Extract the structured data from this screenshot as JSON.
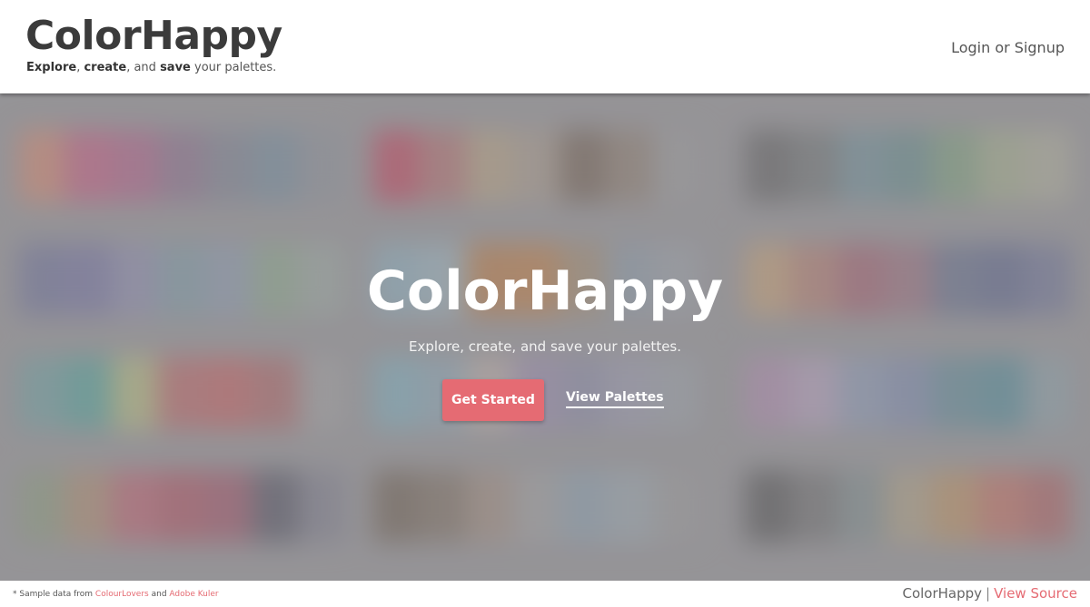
{
  "header": {
    "logo": "ColorHappy",
    "tagline": {
      "word1": "Explore",
      "sep1": ", ",
      "word2": "create",
      "sep2": ", and ",
      "word3": "save",
      "rest": " your palettes."
    },
    "login_label": "Login or Signup"
  },
  "hero": {
    "title": "ColorHappy",
    "subtitle": "Explore, create, and save your palettes.",
    "primary_button": "Get Started",
    "secondary_link": "View Palettes",
    "palettes": [
      [
        "#d9856a",
        "#c8567e",
        "#b35a86",
        "#8a6a8a",
        "#7a7f90",
        "#6f8a9c",
        "#8a8f98"
      ],
      [
        "#c63a55",
        "#b66a6a",
        "#b9a27e",
        "#a99a8a",
        "#6e5a4a",
        "#8c7a6a",
        "#9a9a9a"
      ],
      [
        "#5a5a5a",
        "#6a7070",
        "#6a8e98",
        "#5f8a8a",
        "#7aa07a",
        "#a4b08a",
        "#b0b09a"
      ],
      [
        "#6a6e9a",
        "#6f6ea2",
        "#8a8ab0",
        "#7a9aa6",
        "#8a9ab0",
        "#8aa88a",
        "#9aa8a0"
      ],
      [
        "#8ab0c0",
        "#9ab6c2",
        "#c0783a",
        "#c47a3a",
        "#a48a6a",
        "#8a9aa8",
        "#9aa0a8"
      ],
      [
        "#caa070",
        "#b87a6a",
        "#a45a6a",
        "#9a6a7a",
        "#5f6a8a",
        "#56608a",
        "#6a7096"
      ],
      [
        "#6aa0a0",
        "#4aa49a",
        "#b8c07a",
        "#c06060",
        "#c85a5a",
        "#b06060",
        "#a0a0a0"
      ],
      [
        "#7ab0c0",
        "#8aa8b8",
        "#c0b0a8",
        "#9a8ab0",
        "#8a8aa8",
        "#9a9ab0",
        "#9aa0a8"
      ],
      [
        "#b08ab0",
        "#b6a0c0",
        "#8a9ab8",
        "#7a8ab0",
        "#5a8a98",
        "#4a8a98",
        "#8aa0a8"
      ],
      [
        "#8a9a7a",
        "#b08a6a",
        "#c05a6a",
        "#b04a5a",
        "#a04a60",
        "#4a4a5a",
        "#7a7a8a"
      ],
      [
        "#6a5a4a",
        "#7a6a5a",
        "#a08a7a",
        "#a0a0a0",
        "#8aa0b0",
        "#9aa8b0",
        "#9a9a9a"
      ],
      [
        "#4a4a4a",
        "#6a6a6a",
        "#7a8a8a",
        "#b0a080",
        "#c0905a",
        "#c86a5a",
        "#b05a5a"
      ]
    ]
  },
  "footer": {
    "note_prefix": "* Sample data from ",
    "source1": "ColourLovers",
    "note_mid": " and ",
    "source2": "Adobe Kuler",
    "brand": "ColorHappy",
    "separator": "|",
    "view_source": "View Source",
    "accent_color": "#e56b73"
  }
}
